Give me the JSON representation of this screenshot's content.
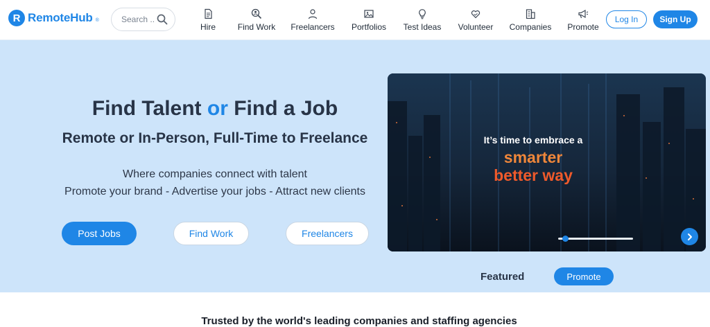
{
  "brand": {
    "name": "RemoteHub",
    "mark": "R",
    "reg": "®"
  },
  "search": {
    "placeholder": "Search ..."
  },
  "nav": [
    {
      "label": "Hire",
      "icon": "document-icon"
    },
    {
      "label": "Find Work",
      "icon": "magnifier-user-icon"
    },
    {
      "label": "Freelancers",
      "icon": "person-icon"
    },
    {
      "label": "Portfolios",
      "icon": "image-icon"
    },
    {
      "label": "Test Ideas",
      "icon": "lightbulb-icon"
    },
    {
      "label": "Volunteer",
      "icon": "heart-hands-icon"
    },
    {
      "label": "Companies",
      "icon": "building-icon"
    },
    {
      "label": "Promote",
      "icon": "megaphone-icon"
    }
  ],
  "auth": {
    "login": "Log In",
    "signup": "Sign Up"
  },
  "hero": {
    "title_part1": "Find Talent ",
    "title_accent": "or",
    "title_part2": " Find a Job",
    "subtitle": "Remote or In-Person, Full-Time to Freelance",
    "line1": "Where companies connect with talent",
    "line2": "Promote your brand - Advertise your jobs - Attract new clients",
    "cta_post": "Post Jobs",
    "cta_find": "Find Work",
    "cta_freelancers": "Freelancers"
  },
  "promo": {
    "line1": "It’s time to embrace a",
    "line2": "smarter",
    "line3": "better way",
    "progress": 0.06
  },
  "featured": {
    "label": "Featured",
    "button": "Promote"
  },
  "trusted": "Trusted by the world's leading companies and staffing agencies",
  "colors": {
    "accent": "#1f86e6",
    "hero_bg": "#cde4fa",
    "orange": "#f0873a",
    "red_orange": "#ef5a2b"
  }
}
